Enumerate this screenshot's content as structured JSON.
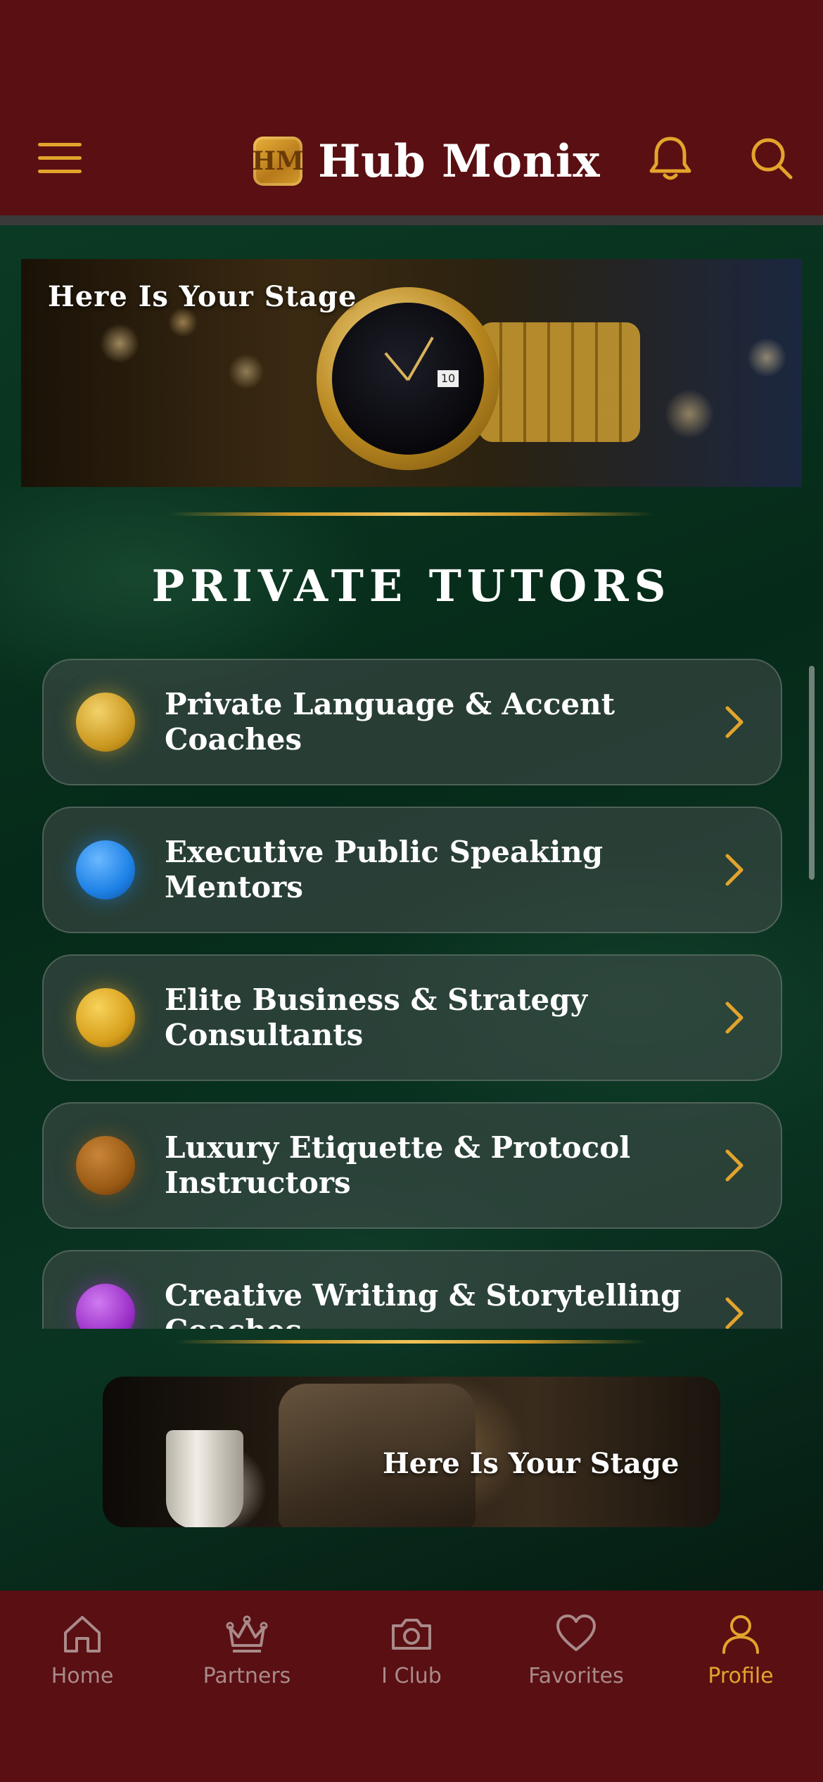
{
  "header": {
    "title": "Hub Monix",
    "logo_text": "HM",
    "icons": [
      "menu-icon",
      "bell-icon",
      "search-icon"
    ]
  },
  "hero": {
    "caption": "Here Is Your Stage",
    "watch_date": "10"
  },
  "section": {
    "title": "PRIVATE TUTORS"
  },
  "categories": [
    {
      "label": "Private Language & Accent Coaches",
      "color": "#d4a52a"
    },
    {
      "label": "Executive Public Speaking Mentors",
      "color": "#1e82e6"
    },
    {
      "label": "Elite Business & Strategy Consultants",
      "color": "#d8a01c"
    },
    {
      "label": "Luxury Etiquette & Protocol Instructors",
      "color": "#9a5a14"
    },
    {
      "label": "Creative Writing & Storytelling Coaches",
      "color": "#9b30c8"
    }
  ],
  "promo": {
    "caption": "Here Is Your Stage"
  },
  "bottom_nav": {
    "items": [
      {
        "label": "Home",
        "icon": "home-icon"
      },
      {
        "label": "Partners",
        "icon": "crown-icon"
      },
      {
        "label": "I Club",
        "icon": "camera-icon"
      },
      {
        "label": "Favorites",
        "icon": "heart-icon"
      },
      {
        "label": "Profile",
        "icon": "user-icon",
        "active": true
      }
    ],
    "active_color": "#e3a42c",
    "inactive_color": "#a98a8a"
  },
  "colors": {
    "header_bg": "#5a0f12",
    "accent_gold": "#e3a42c"
  }
}
